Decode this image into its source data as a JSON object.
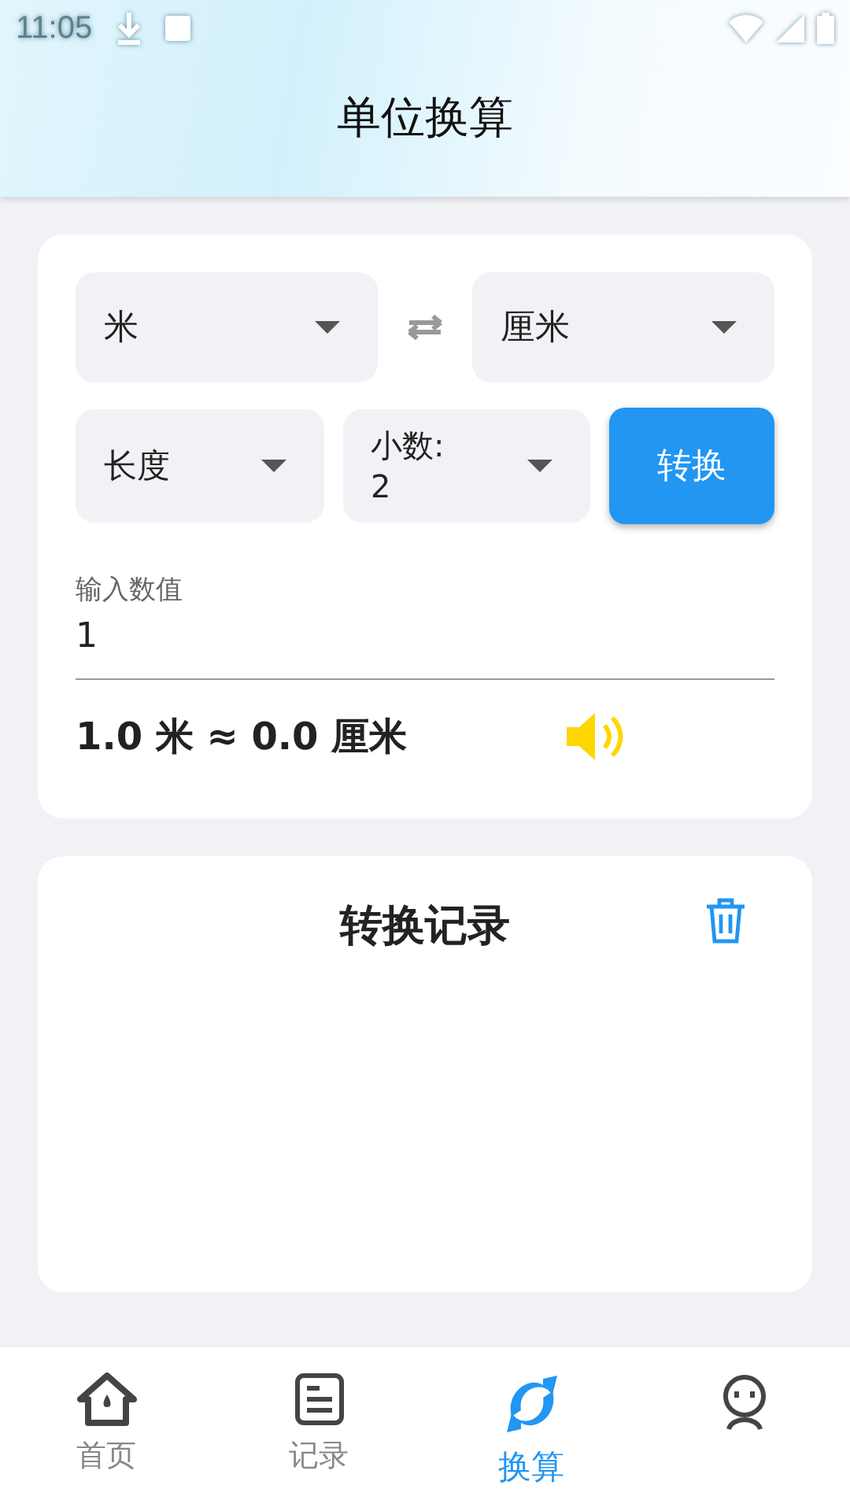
{
  "status_bar": {
    "time": "11:05"
  },
  "header": {
    "title": "单位换算"
  },
  "converter": {
    "from_unit": "米",
    "to_unit": "厘米",
    "category": "长度",
    "decimals": "小数:\n2",
    "convert_button": "转换",
    "input": {
      "label": "输入数值",
      "value": "1"
    },
    "result": "1.0 米 ≈ 0.0 厘米"
  },
  "history": {
    "title": "转换记录"
  },
  "tabs": [
    {
      "kind": "home",
      "label": "首页",
      "selected": false
    },
    {
      "kind": "records",
      "label": "记录",
      "selected": false
    },
    {
      "kind": "convert",
      "label": "换算",
      "selected": true
    },
    {
      "kind": "profile",
      "selected": false
    }
  ]
}
